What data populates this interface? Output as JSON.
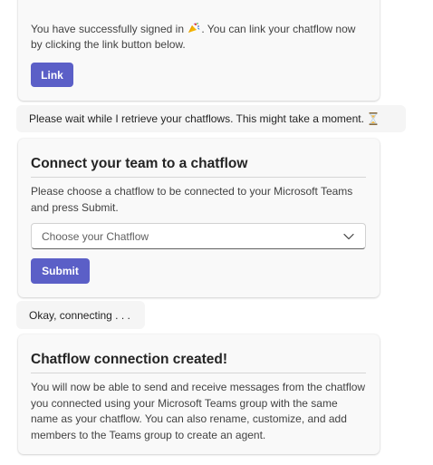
{
  "signin_card": {
    "text_before": "You have successfully signed in",
    "icon": "party-popper-icon",
    "text_after": ". You can link your chatflow now by clicking the link button below.",
    "link_button": "Link"
  },
  "wait_message": {
    "text": "Please wait while I retrieve your chatflows. This might take a moment.",
    "icon": "hourglass-icon"
  },
  "connect_card": {
    "title": "Connect your team to a chatflow",
    "description": "Please choose a chatflow to be connected to your Microsoft Teams and press Submit.",
    "dropdown_placeholder": "Choose your Chatflow",
    "submit_button": "Submit"
  },
  "connecting_message": {
    "text": "Okay, connecting . . ."
  },
  "created_card": {
    "title": "Chatflow connection created!",
    "description": "You will now be able to send and receive messages from the chatflow you connected using your Microsoft Teams group with the same name as your chatflow. You can also rename, customize, and add members to the Teams group to create an agent."
  },
  "colors": {
    "accent": "#5b5fc7",
    "card_background": "#f9f9f9",
    "bubble_background": "#f5f5f5"
  }
}
